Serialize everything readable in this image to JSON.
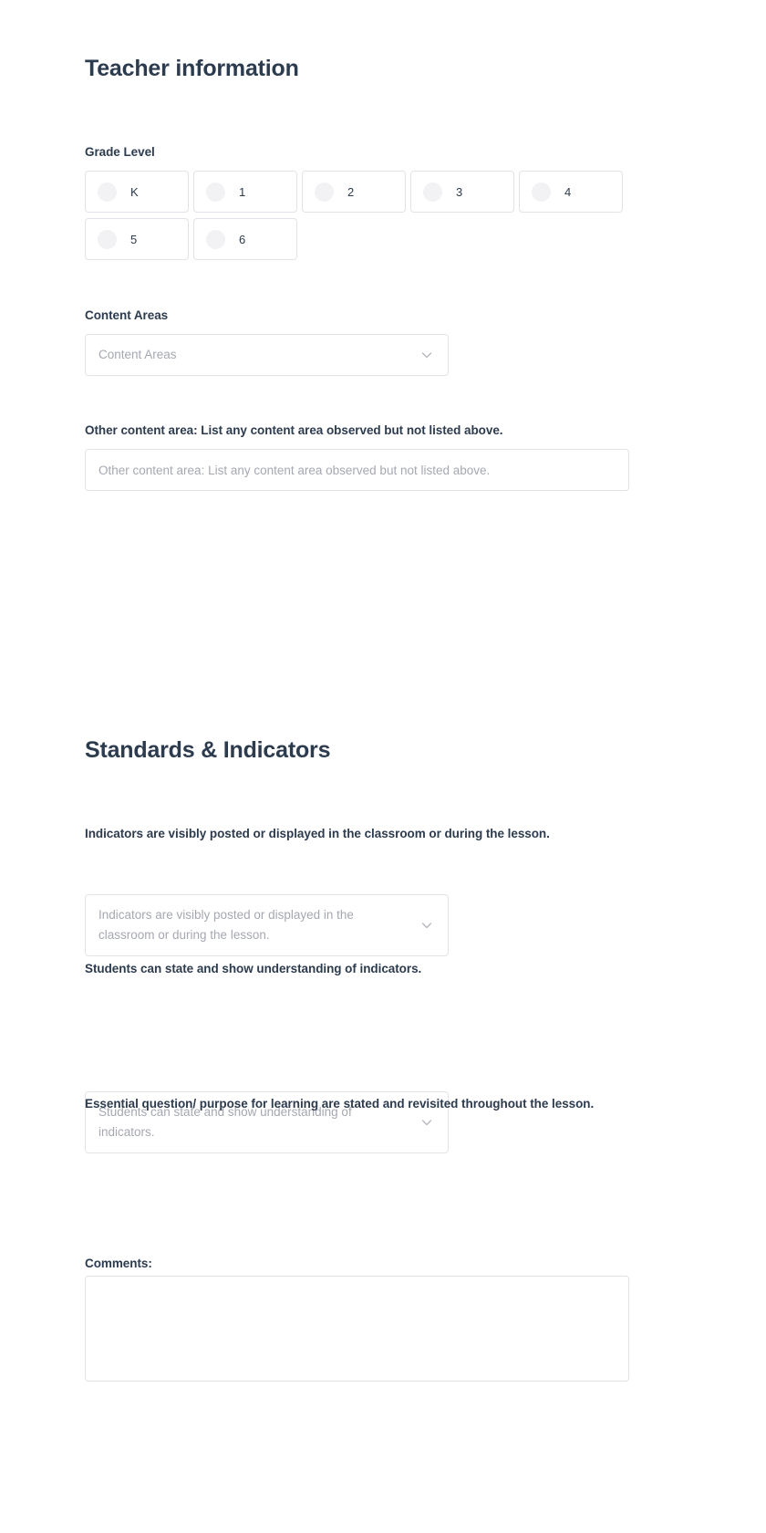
{
  "sections": {
    "teacher_information": {
      "title": "Teacher information",
      "grade_level": {
        "label": "Grade Level",
        "options": [
          {
            "value": "K"
          },
          {
            "value": "1"
          },
          {
            "value": "2"
          },
          {
            "value": "3"
          },
          {
            "value": "4"
          },
          {
            "value": "5"
          },
          {
            "value": "6"
          }
        ]
      },
      "content_areas": {
        "label": "Content Areas",
        "placeholder": "Content Areas",
        "value": ""
      },
      "other_content_area": {
        "label": "Other content area: List any content area observed but not listed above.",
        "placeholder": "Other content area: List any content area observed but not listed above.",
        "value": ""
      }
    },
    "standards_and_indicators": {
      "title": "Standards & Indicators",
      "questions": [
        {
          "label": "Indicators are visibly posted or displayed in the classroom or during the lesson.",
          "placeholder": "Indicators are visibly posted or displayed in the classroom or during the lesson.",
          "value": ""
        },
        {
          "label": "Students can state and show understanding of indicators.",
          "placeholder": "Students can state and show understanding of indicators.",
          "value": ""
        },
        {
          "label": "Essential question/ purpose for learning are stated and revisited throughout the lesson.",
          "placeholder": "Essential question/ purpose for learning are stated and revisited throughout the lesson.",
          "value": ""
        }
      ],
      "comments": {
        "label": "Comments:",
        "placeholder": "",
        "value": ""
      }
    }
  },
  "icons": {
    "chevron_down": "chevron-down-icon",
    "radio": "radio-circle-icon"
  },
  "colors": {
    "heading": "#2d3b4e",
    "label": "#2d3b4e",
    "placeholder": "#a6a8b1",
    "border": "#e2e3e6",
    "radio_fill": "#f2f2f4",
    "background": "#ffffff"
  }
}
